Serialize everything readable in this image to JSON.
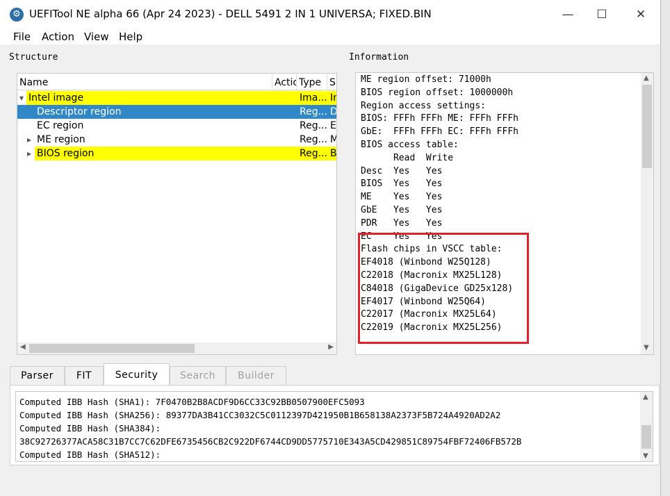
{
  "window": {
    "title": "UEFITool NE alpha 66 (Apr 24 2023) - DELL 5491 2 IN 1 UNIVERSA; FIXED.BIN",
    "minimize": "—",
    "maximize": "☐",
    "close": "✕"
  },
  "menu": [
    "File",
    "Action",
    "View",
    "Help"
  ],
  "structure": {
    "label": "Structure",
    "columns": [
      "Name",
      "Actio",
      "Type",
      "Su"
    ],
    "rows": [
      {
        "name": "Intel image",
        "type": "Ima...",
        "sub": "In",
        "expander": "▾",
        "state": "highlight"
      },
      {
        "name": "Descriptor region",
        "type": "Reg...",
        "sub": "D",
        "expander": "",
        "state": "selected"
      },
      {
        "name": "EC region",
        "type": "Reg...",
        "sub": "EC",
        "expander": "",
        "state": ""
      },
      {
        "name": "ME region",
        "type": "Reg...",
        "sub": "M",
        "expander": "▸",
        "state": ""
      },
      {
        "name": "BIOS region",
        "type": "Reg...",
        "sub": "BI",
        "expander": "▸",
        "state": "highlight"
      }
    ]
  },
  "information": {
    "label": "Information",
    "lines": [
      "ME region offset: 71000h",
      "BIOS region offset: 1000000h",
      "Region access settings:",
      "BIOS: FFFh FFFh ME: FFFh FFFh",
      "GbE:  FFFh FFFh EC: FFFh FFFh",
      "BIOS access table:",
      "      Read  Write",
      "Desc  Yes   Yes",
      "BIOS  Yes   Yes",
      "ME    Yes   Yes",
      "GbE   Yes   Yes",
      "PDR   Yes   Yes",
      "EC    Yes   Yes",
      "Flash chips in VSCC table:",
      "EF4018 (Winbond W25Q128)",
      "C22018 (Macronix MX25L128)",
      "C84018 (GigaDevice GD25x128)",
      "EF4017 (Winbond W25Q64)",
      "C22017 (Macronix MX25L64)",
      "C22019 (Macronix MX25L256)"
    ],
    "annotation_color": "#e3212a"
  },
  "tabs": [
    {
      "label": "Parser",
      "state": "normal"
    },
    {
      "label": "FIT",
      "state": "normal"
    },
    {
      "label": "Security",
      "state": "active"
    },
    {
      "label": "Search",
      "state": "disabled"
    },
    {
      "label": "Builder",
      "state": "disabled"
    }
  ],
  "security_messages": [
    "Computed IBB Hash (SHA1): 7F0470B2B8ACDF9D6CC33C92BB0507900EFC5093",
    "Computed IBB Hash (SHA256): 89377DA3B41CC3032C5C0112397D421950B1B658138A2373F5B724A4920AD2A2",
    "Computed IBB Hash (SHA384):",
    "38C92726377ACA58C31B7CC7C62DFE6735456CB2C922DF6744CD9DD5775710E343A5CD429851C89754FBF72406FB572B",
    "Computed IBB Hash (SHA512):"
  ]
}
